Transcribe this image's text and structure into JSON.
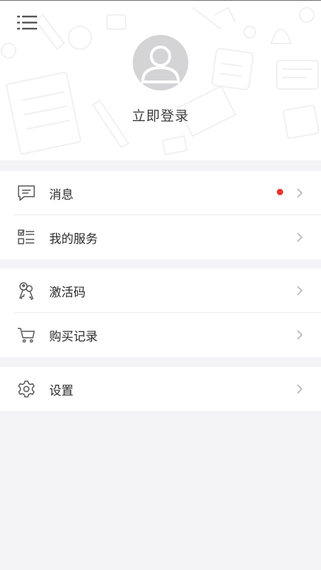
{
  "header": {
    "login_text": "立即登录"
  },
  "groups": [
    {
      "items": [
        {
          "label": "消息",
          "icon": "message-icon",
          "badge": true
        },
        {
          "label": "我的服务",
          "icon": "checklist-icon",
          "badge": false
        }
      ]
    },
    {
      "items": [
        {
          "label": "激活码",
          "icon": "keys-icon",
          "badge": false
        },
        {
          "label": "购买记录",
          "icon": "cart-icon",
          "badge": false
        }
      ]
    },
    {
      "items": [
        {
          "label": "设置",
          "icon": "gear-icon",
          "badge": false
        }
      ]
    }
  ],
  "colors": {
    "badge": "#e53535",
    "background": "#f4f3f5",
    "avatar": "#d4d4d6"
  }
}
